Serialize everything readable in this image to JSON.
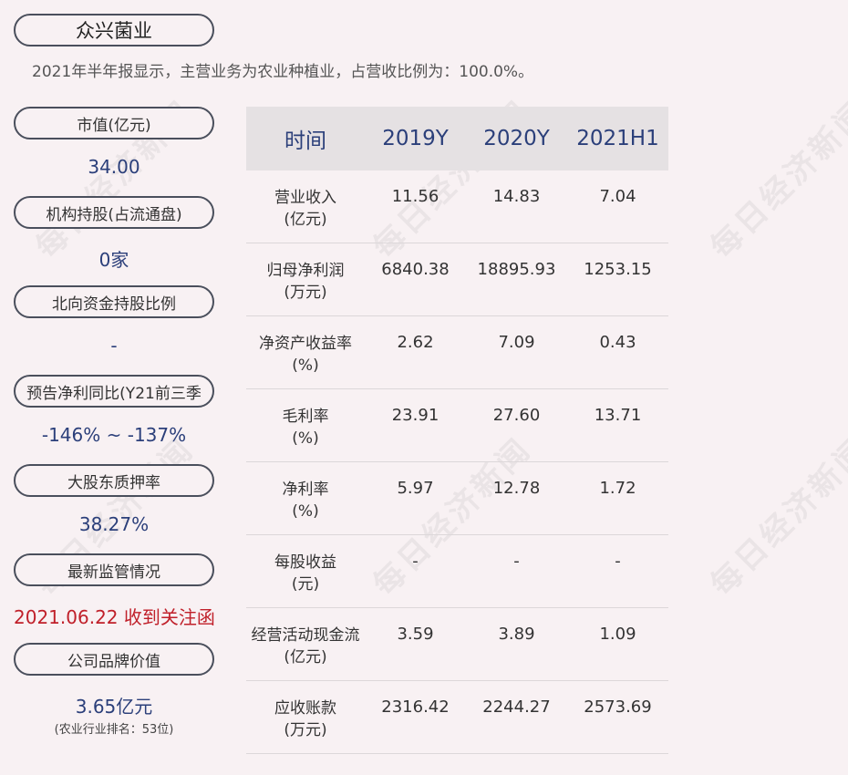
{
  "company": {
    "name": "众兴菌业"
  },
  "summary": {
    "text": "2021年半年报显示，主营业务为农业种植业，占营收比例为：100.0%。"
  },
  "metrics": [
    {
      "label": "市值(亿元)",
      "value": "34.00"
    },
    {
      "label": "机构持股(占流通盘)",
      "value": "0家"
    },
    {
      "label": "北向资金持股比例",
      "value": "-"
    },
    {
      "label": "预告净利同比(Y21前三季",
      "value": "-146% ~ -137%"
    },
    {
      "label": "大股东质押率",
      "value": "38.27%"
    },
    {
      "label": "最新监管情况",
      "value": "2021.06.22 收到关注函"
    },
    {
      "label": "公司品牌价值",
      "value": "3.65亿元",
      "note": "(农业行业排名：53位)"
    }
  ],
  "table": {
    "headers": [
      "时间",
      "2019Y",
      "2020Y",
      "2021H1"
    ],
    "rows": [
      {
        "label": [
          "营业收入",
          "(亿元)"
        ],
        "values": [
          "11.56",
          "14.83",
          "7.04"
        ]
      },
      {
        "label": [
          "归母净利润",
          "(万元)"
        ],
        "values": [
          "6840.38",
          "18895.93",
          "1253.15"
        ]
      },
      {
        "label": [
          "净资产收益率",
          "(%)"
        ],
        "values": [
          "2.62",
          "7.09",
          "0.43"
        ]
      },
      {
        "label": [
          "毛利率",
          "(%)"
        ],
        "values": [
          "23.91",
          "27.60",
          "13.71"
        ]
      },
      {
        "label": [
          "净利率",
          "(%)"
        ],
        "values": [
          "5.97",
          "12.78",
          "1.72"
        ]
      },
      {
        "label": [
          "每股收益",
          "(元)"
        ],
        "values": [
          "-",
          "-",
          "-"
        ]
      },
      {
        "label": [
          "经营活动现金流",
          "(亿元)"
        ],
        "values": [
          "3.59",
          "3.89",
          "1.09"
        ]
      },
      {
        "label": [
          "应收账款",
          "(万元)"
        ],
        "values": [
          "2316.42",
          "2244.27",
          "2573.69"
        ]
      }
    ]
  },
  "watermark": {
    "text": "每日经济新闻"
  },
  "colors": {
    "value_blue": "#2b3f7a",
    "alert_red": "#c0202a",
    "header_bg": "#e5e1e3",
    "page_bg": "#f8f1f3"
  }
}
